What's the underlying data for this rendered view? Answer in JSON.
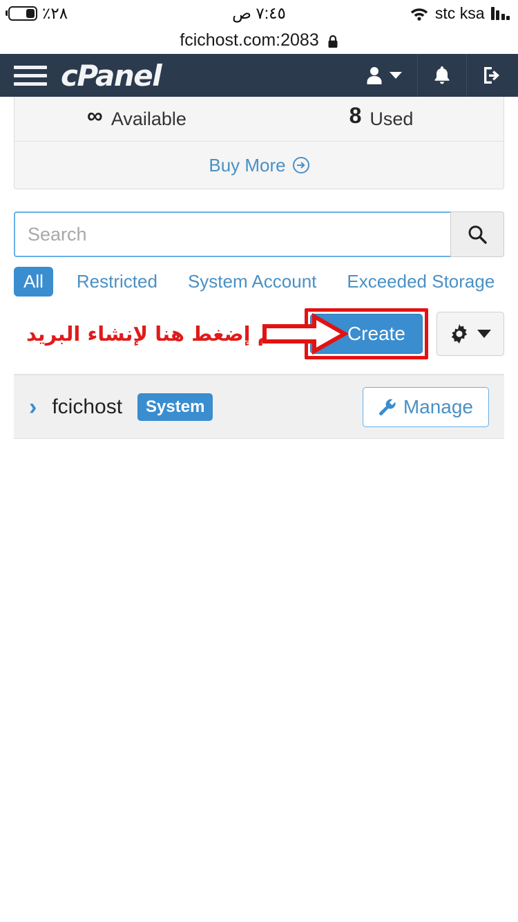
{
  "status_bar": {
    "battery_percent": "٪٢٨",
    "time": "٧:٤٥ ص",
    "carrier": "stc ksa",
    "battery_icon": "battery-icon",
    "wifi_icon": "wifi-icon",
    "signal_icon": "signal-bars-icon"
  },
  "browser": {
    "url": "fcichost.com:2083",
    "lock_icon": "lock-icon"
  },
  "header": {
    "brand": "cPanel",
    "menu_icon": "hamburger-menu-icon",
    "user_icon": "user-icon",
    "user_caret_icon": "chevron-down-icon",
    "notifications_icon": "bell-icon",
    "logout_icon": "logout-icon"
  },
  "stats": {
    "available_value": "∞",
    "available_label": "Available",
    "used_value": "8",
    "used_label": "Used",
    "buy_more_label": "Buy More",
    "buy_more_icon": "arrow-circle-right-icon"
  },
  "search": {
    "value": "",
    "placeholder": "Search",
    "button_icon": "search-icon"
  },
  "filters": [
    {
      "label": "All",
      "active": true
    },
    {
      "label": "Restricted",
      "active": false
    },
    {
      "label": "System Account",
      "active": false
    },
    {
      "label": "Exceeded Storage",
      "active": false
    }
  ],
  "actions": {
    "annotation_text": "ثم إضغط هنا لإنشاء البريد",
    "annotation_color": "#e01b1b",
    "arrow_icon": "arrow-right-annotation-icon",
    "create_label": "Create",
    "create_plus_icon": "plus-icon",
    "create_color": "#3a8dcf",
    "highlight_color": "#e31212",
    "settings_icon": "gear-icon",
    "settings_caret_icon": "caret-down-icon"
  },
  "accounts": [
    {
      "expand_icon": "chevron-right-icon",
      "name": "fcichost",
      "badge": "System",
      "manage_label": "Manage",
      "manage_icon": "wrench-icon"
    }
  ],
  "theme": {
    "header_bg": "#2b3a4d",
    "accent_blue": "#3a8dcf",
    "link_blue": "#4a90c4",
    "page_bg": "#ffffff",
    "card_bg": "#f5f5f5"
  }
}
